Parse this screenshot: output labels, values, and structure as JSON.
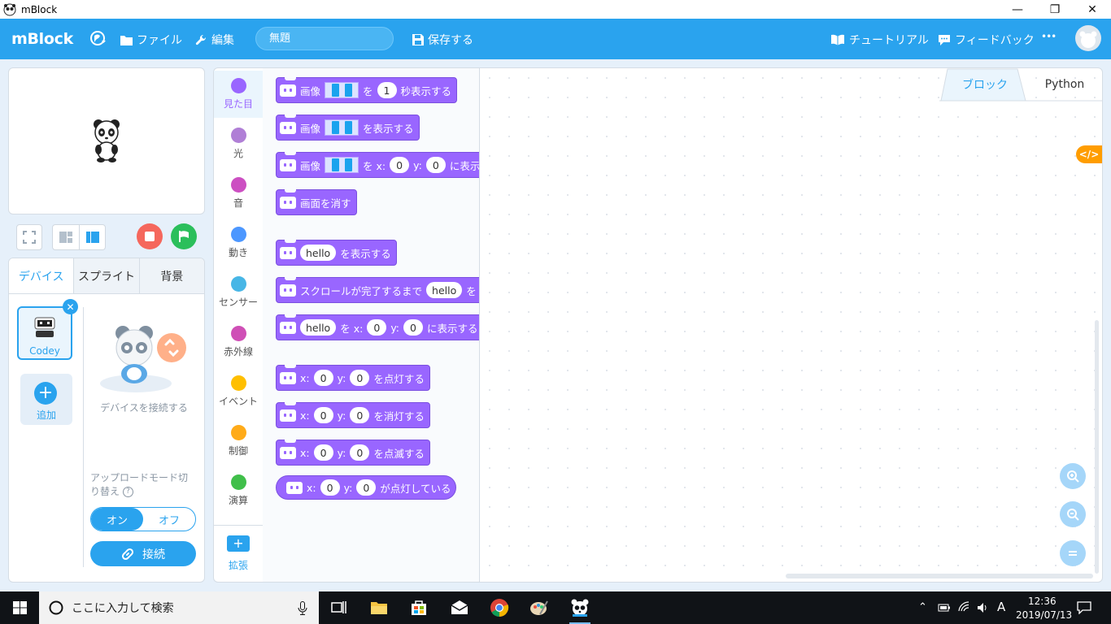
{
  "window": {
    "title": "mBlock",
    "controls": [
      "—",
      "❐",
      "✕"
    ]
  },
  "header": {
    "brand": "mBlock",
    "file": "ファイル",
    "edit": "編集",
    "project_name": "無題",
    "save": "保存する",
    "tutorial": "チュートリアル",
    "feedback": "フィードバック",
    "more": "•••"
  },
  "devices": {
    "tabs": [
      "デバイス",
      "スプライト",
      "背景"
    ],
    "device_name": "Codey",
    "add_label": "追加",
    "connect_hint": "デバイスを接続する",
    "upload_mode": "アップロードモード切り替え",
    "toggle_on": "オン",
    "toggle_off": "オフ",
    "connect_button": "接続"
  },
  "categories": [
    {
      "label": "見た目",
      "color": "#9966ff"
    },
    {
      "label": "光",
      "color": "#b07fd6"
    },
    {
      "label": "音",
      "color": "#cc4fc2"
    },
    {
      "label": "動き",
      "color": "#4c97ff"
    },
    {
      "label": "センサー",
      "color": "#47b6e6"
    },
    {
      "label": "赤外線",
      "color": "#cf4fb6"
    },
    {
      "label": "イベント",
      "color": "#ffbf00"
    },
    {
      "label": "制御",
      "color": "#ffab19"
    },
    {
      "label": "演算",
      "color": "#40bf4a"
    }
  ],
  "extension_label": "拡張",
  "blocks": {
    "b1": {
      "a": "画像",
      "b": "を",
      "n": "1",
      "c": "秒表示する"
    },
    "b2": {
      "a": "画像",
      "b": "を表示する"
    },
    "b3": {
      "a": "画像",
      "b": "を x:",
      "x": "0",
      "y_label": "y:",
      "y": "0",
      "c": "に表示"
    },
    "b4": {
      "a": "画面を消す"
    },
    "b5": {
      "t": "hello",
      "a": "を表示する"
    },
    "b6": {
      "a": "スクロールが完了するまで",
      "t": "hello",
      "b": "を"
    },
    "b7": {
      "t": "hello",
      "a": "を x:",
      "x": "0",
      "y_label": "y:",
      "y": "0",
      "c": "に表示する"
    },
    "b8": {
      "x_label": "x:",
      "x": "0",
      "y_label": "y:",
      "y": "0",
      "a": "を点灯する"
    },
    "b9": {
      "x_label": "x:",
      "x": "0",
      "y_label": "y:",
      "y": "0",
      "a": "を消灯する"
    },
    "b10": {
      "x_label": "x:",
      "x": "0",
      "y_label": "y:",
      "y": "0",
      "a": "を点滅する"
    },
    "b11": {
      "x_label": "x:",
      "x": "0",
      "y_label": "y:",
      "y": "0",
      "a": "が点灯している"
    }
  },
  "workspace": {
    "tab_blocks": "ブロック",
    "tab_python": "Python",
    "code_icon": "</>"
  },
  "taskbar": {
    "search_placeholder": "ここに入力して検索",
    "time": "12:36",
    "date": "2019/07/13",
    "ime": "A"
  },
  "colors": {
    "accent": "#2aa3ee",
    "looks": "#9966ff",
    "stop": "#f5675c",
    "go": "#2bbf5b",
    "code_tab": "#ff9d00"
  }
}
